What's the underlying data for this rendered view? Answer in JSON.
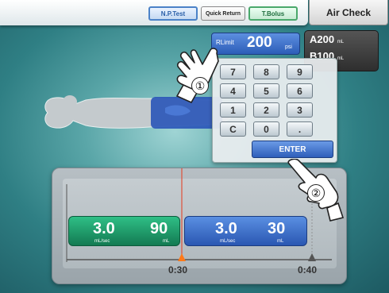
{
  "topbar": {
    "buttons": [
      "N.P.Test",
      "Quick Return",
      "T.Bolus"
    ],
    "air_check": "Air Check"
  },
  "pressure_limit": {
    "label": "RLimit",
    "value": "200",
    "unit": "psi"
  },
  "volumes": [
    {
      "label": "A200",
      "unit": "mL"
    },
    {
      "label": "B100",
      "unit": "mL"
    }
  ],
  "keypad": {
    "rows": [
      [
        "7",
        "8",
        "9"
      ],
      [
        "4",
        "5",
        "6"
      ],
      [
        "1",
        "2",
        "3"
      ],
      [
        "C",
        "0",
        "."
      ]
    ],
    "enter": "ENTER"
  },
  "timeline": {
    "phases": [
      {
        "rate": "3.0",
        "rate_unit": "mL/sec",
        "volume": "90",
        "volume_unit": "mL",
        "color": "#1f9a68"
      },
      {
        "rate": "3.0",
        "rate_unit": "mL/sec",
        "volume": "30",
        "volume_unit": "mL",
        "color": "#3c6fcc"
      }
    ],
    "time_marks": [
      "0:30",
      "0:40"
    ]
  },
  "steps": [
    "①",
    "②"
  ],
  "colors": {
    "accent_blue": "#2c5db8",
    "accent_green": "#137a52",
    "marker_orange": "#ff7a1a"
  }
}
